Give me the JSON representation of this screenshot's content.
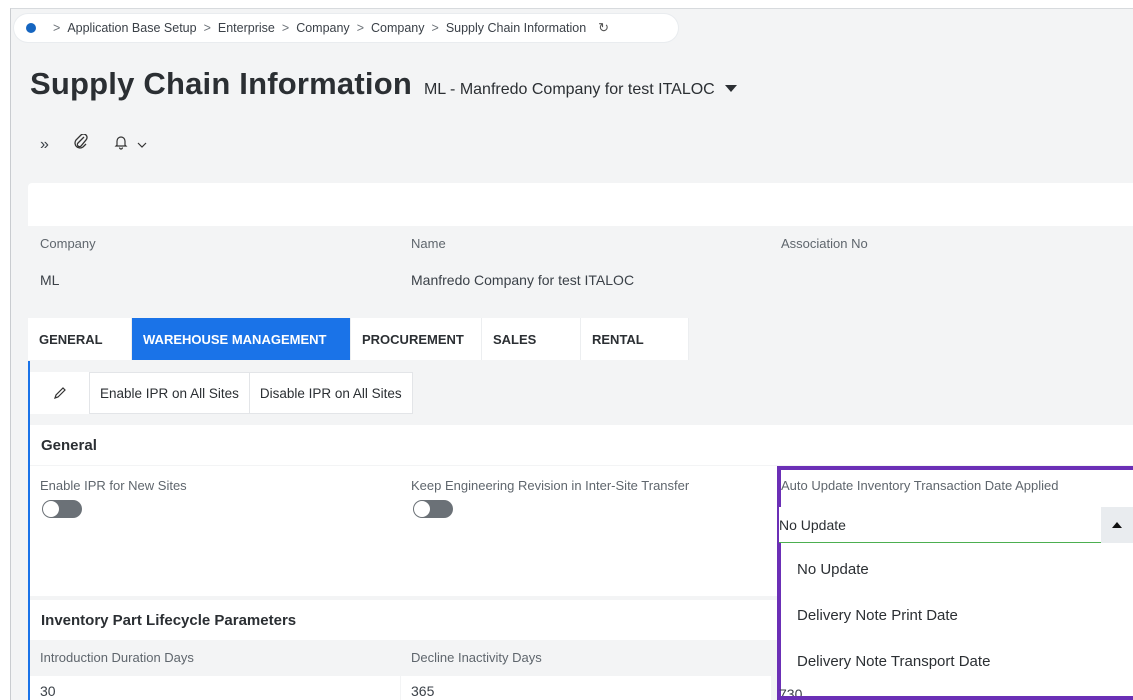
{
  "breadcrumb": {
    "items": [
      "Application Base Setup",
      "Enterprise",
      "Company",
      "Company",
      "Supply Chain Information"
    ],
    "sep": ">"
  },
  "title": {
    "main": "Supply Chain Information",
    "sub": "ML - Manfredo Company for test ITALOC"
  },
  "commands": {
    "expand": "»",
    "attach": "✎",
    "bell": "🔔",
    "chevron": "⌄"
  },
  "header": {
    "company_label": "Company",
    "company_value": "ML",
    "name_label": "Name",
    "name_value": "Manfredo Company for test ITALOC",
    "assoc_label": "Association No"
  },
  "tabs": [
    {
      "label": "GENERAL"
    },
    {
      "label": "WAREHOUSE MANAGEMENT"
    },
    {
      "label": "PROCUREMENT"
    },
    {
      "label": "SALES"
    },
    {
      "label": "RENTAL"
    }
  ],
  "toolbar": {
    "enable_ipr": "Enable IPR on All Sites",
    "disable_ipr": "Disable IPR on All Sites"
  },
  "general": {
    "heading": "General",
    "enable_ipr_new_label": "Enable IPR for New Sites",
    "keep_eng_rev_label": "Keep Engineering Revision in Inter-Site Transfer",
    "auto_update_label": "Auto Update Inventory Transaction Date Applied",
    "auto_update_value": "No Update",
    "options": [
      "No Update",
      "Delivery Note Print Date",
      "Delivery Note Transport Date"
    ]
  },
  "lifecycle": {
    "heading": "Inventory Part Lifecycle Parameters",
    "intro_label": "Introduction Duration Days",
    "intro_value": "30",
    "decline_label": "Decline Inactivity Days",
    "decline_value": "365",
    "third_value": "730"
  },
  "colors": {
    "accent": "#1a73e8",
    "highlight": "#6b2fb6"
  }
}
